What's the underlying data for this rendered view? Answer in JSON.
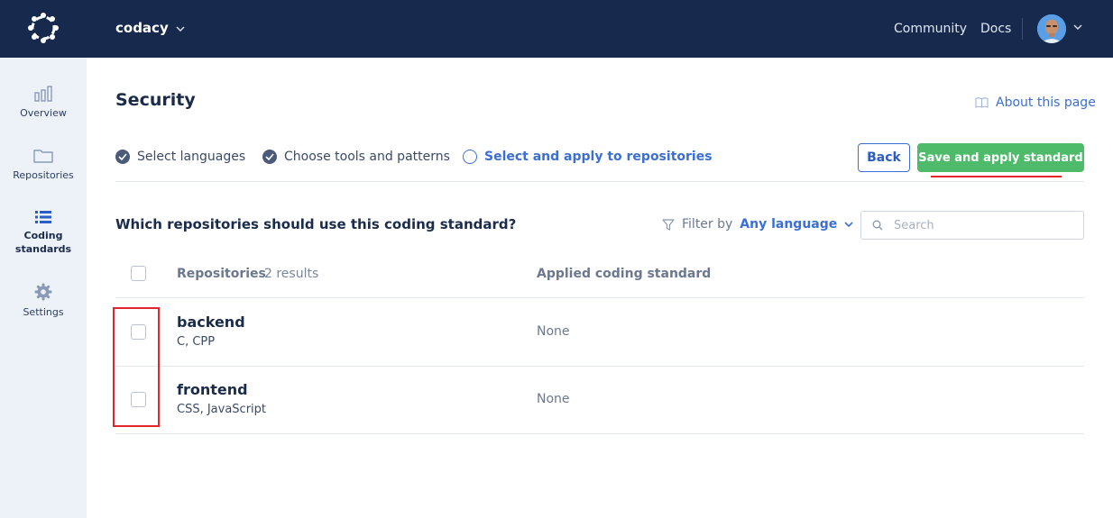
{
  "topbar": {
    "org_name": "codacy",
    "links": {
      "community": "Community",
      "docs": "Docs"
    },
    "background_color": "#172a4d"
  },
  "sidebar": {
    "items": [
      {
        "label": "Overview",
        "icon": "bar-chart-icon"
      },
      {
        "label": "Repositories",
        "icon": "folder-icon"
      },
      {
        "label": "Coding\nstandards",
        "label_line1": "Coding",
        "label_line2": "standards",
        "icon": "list-icon",
        "active": true
      },
      {
        "label": "Settings",
        "icon": "gear-icon"
      }
    ]
  },
  "page": {
    "title": "Security",
    "about_link": "About this page"
  },
  "steps": [
    {
      "label": "Select languages",
      "state": "done"
    },
    {
      "label": "Choose tools and patterns",
      "state": "done"
    },
    {
      "label": "Select and apply to repositories",
      "state": "current"
    }
  ],
  "actions": {
    "back_label": "Back",
    "save_label": "Save and apply standard",
    "primary_color": "#4dbb6a",
    "accent_color": "#3b6fd4"
  },
  "selection": {
    "question": "Which repositories should use this coding standard?",
    "filter_label": "Filter by",
    "filter_value": "Any language",
    "search_placeholder": "Search"
  },
  "table": {
    "columns": {
      "repositories": "Repositories",
      "applied_standard": "Applied coding standard"
    },
    "result_count": "2 results",
    "rows": [
      {
        "name": "backend",
        "languages": "C, CPP",
        "applied_standard": "None",
        "checked": false
      },
      {
        "name": "frontend",
        "languages": "CSS, JavaScript",
        "applied_standard": "None",
        "checked": false
      }
    ]
  }
}
